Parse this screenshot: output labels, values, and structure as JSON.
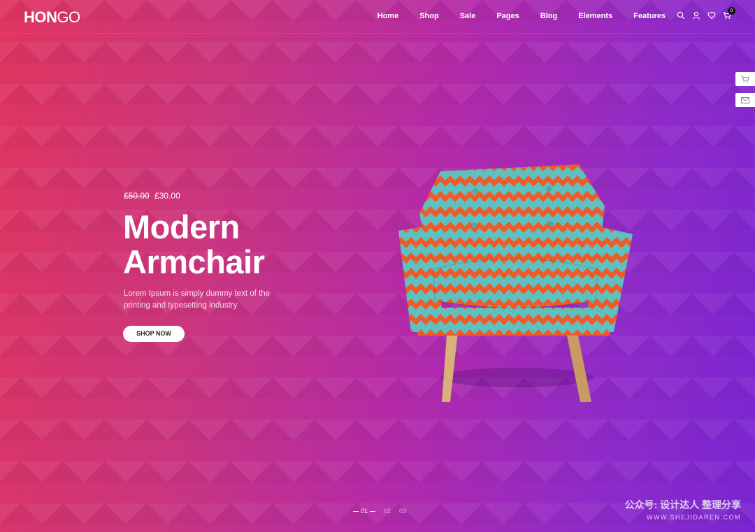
{
  "brand": {
    "logo_bold": "HON",
    "logo_light": "GO"
  },
  "nav": {
    "items": [
      "Home",
      "Shop",
      "Sale",
      "Pages",
      "Blog",
      "Elements",
      "Features"
    ]
  },
  "header_icons": [
    "search-icon",
    "user-icon",
    "heart-icon",
    "cart-icon"
  ],
  "cart": {
    "count": "0"
  },
  "side_buttons": [
    "cart-icon",
    "mail-icon"
  ],
  "hero": {
    "old_price": "£50.00",
    "price": "£30.00",
    "title_line1": "Modern",
    "title_line2": "Armchair",
    "desc_line1": "Lorem Ipsum is simply dummy text of the",
    "desc_line2": "printing and typesetting industry",
    "cta": "SHOP NOW"
  },
  "pager": {
    "current": "01",
    "p2": "02",
    "p3": "03"
  },
  "watermark": {
    "top": "公众号: 设计达人 整理分享",
    "sub": "WWW.SHEJIDAREN.COM"
  },
  "colors": {
    "gradient_start": "#e0355f",
    "gradient_end": "#7a26d2",
    "chair_red": "#f05a28",
    "chair_teal": "#5fc0c0",
    "leg_wood": "#d9b07a"
  }
}
